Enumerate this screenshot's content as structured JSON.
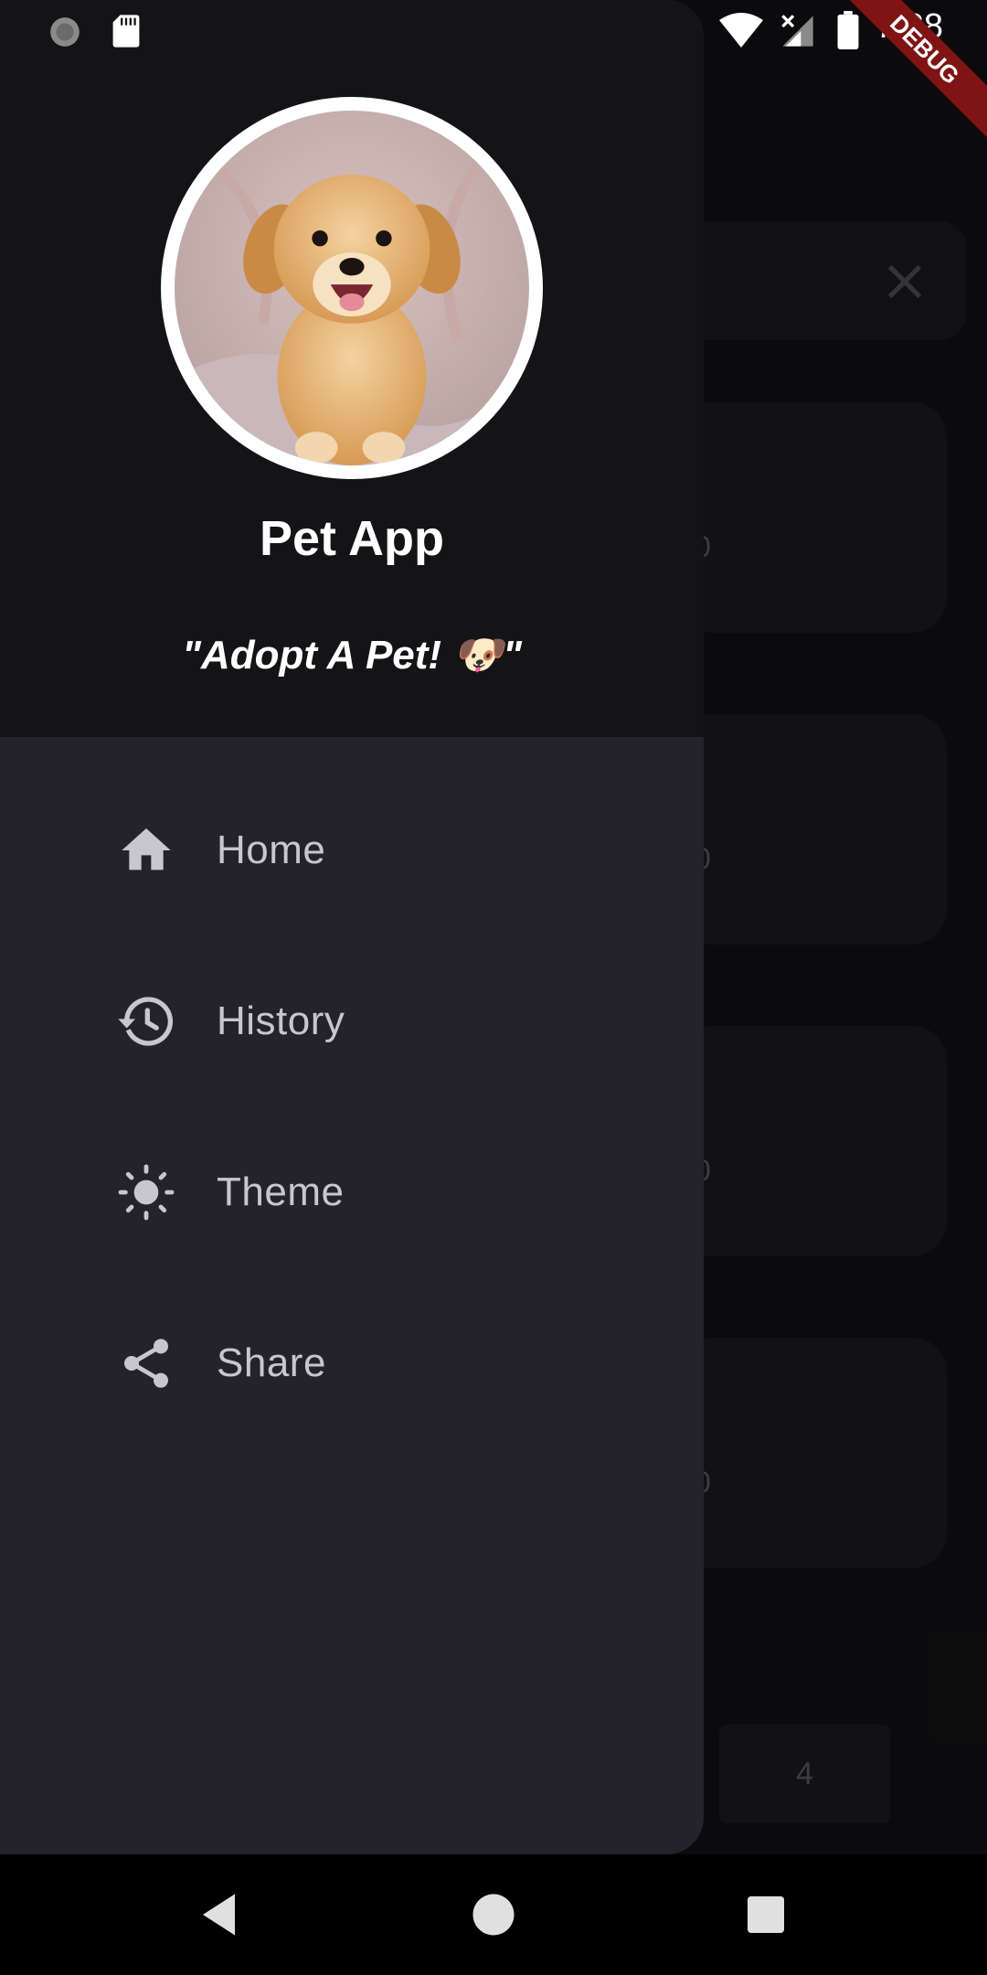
{
  "status_bar": {
    "time": "7:38",
    "debug_banner": "DEBUG",
    "icons": [
      "sync-icon",
      "sd-card-icon",
      "wifi-icon",
      "cellular-no-signal-icon",
      "battery-icon"
    ]
  },
  "drawer": {
    "app_name": "Pet App",
    "tagline": "\"Adopt A Pet! 🐶\"",
    "avatar": "puppy-photo",
    "menu": [
      {
        "label": "Home",
        "icon": "home-icon"
      },
      {
        "label": "History",
        "icon": "history-icon"
      },
      {
        "label": "Theme",
        "icon": "sun-icon"
      },
      {
        "label": "Share",
        "icon": "share-icon"
      }
    ]
  },
  "background": {
    "card_partial_text": [
      "0",
      "0",
      "0",
      "0"
    ],
    "page_number": "4"
  },
  "nav_bar": {
    "buttons": [
      "back-button",
      "home-button",
      "recents-button"
    ]
  },
  "colors": {
    "drawer_bg": "#24232a",
    "header_bg": "#141417",
    "menu_text": "#c8c7cf",
    "debug_ribbon": "#7f1414"
  }
}
